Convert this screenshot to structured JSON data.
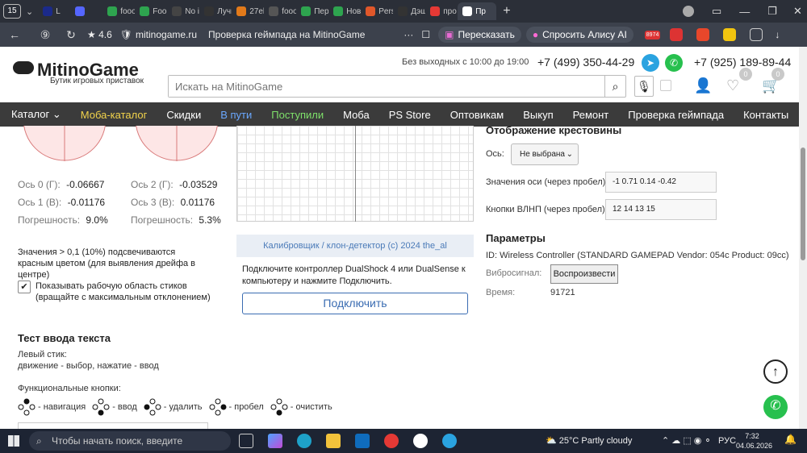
{
  "browser": {
    "tab_count": "15",
    "tabs": [
      {
        "label": "L",
        "color": "#1b2a8a"
      },
      {
        "label": "",
        "color": "#5566ff"
      },
      {
        "label": "fooo",
        "color": "#2ea44f"
      },
      {
        "label": "Food",
        "color": "#2ea44f"
      },
      {
        "label": "No il",
        "color": "#444"
      },
      {
        "label": "Лучи",
        "color": "#333"
      },
      {
        "label": "27el",
        "color": "#e27a1a"
      },
      {
        "label": "fooo",
        "color": "#555"
      },
      {
        "label": "Пер",
        "color": "#2ea44f"
      },
      {
        "label": "Нов",
        "color": "#2ea44f"
      },
      {
        "label": "Pers",
        "color": "#e0572a"
      },
      {
        "label": "Дэш",
        "color": "#333"
      },
      {
        "label": "про",
        "color": "#e53935"
      },
      {
        "label": "Пр",
        "color": "#fff",
        "active": true
      }
    ],
    "rating": "★ 4.6",
    "domain": "mitinogame.ru",
    "page_title": "Проверка геймпада на MitinoGame",
    "retell_label": "Пересказать",
    "alice_label": "Спросить Алису AI",
    "ext_badge": "8974"
  },
  "site": {
    "logo": "MitinoGame",
    "logo_sub": "Бутик игровых приставок",
    "hours": "Без выходных с 10:00 до 19:00",
    "phone1": "+7 (499) 350-44-29",
    "phone2": "+7 (925) 189-89-44",
    "search_placeholder": "Искать на MitinoGame",
    "fav_count": "0",
    "cart_count": "0",
    "menu": [
      {
        "label": "Каталог ⌄",
        "color": "#ffffff"
      },
      {
        "label": "Моба-каталог",
        "color": "#f2d34b"
      },
      {
        "label": "Скидки",
        "color": "#ffffff"
      },
      {
        "label": "В пути",
        "color": "#6aa8ff"
      },
      {
        "label": "Поступили",
        "color": "#7ee06a"
      },
      {
        "label": "Моба",
        "color": "#ffffff"
      },
      {
        "label": "PS Store",
        "color": "#ffffff"
      },
      {
        "label": "Оптовикам",
        "color": "#ffffff"
      },
      {
        "label": "Выкуп",
        "color": "#ffffff"
      },
      {
        "label": "Ремонт",
        "color": "#ffffff"
      },
      {
        "label": "Проверка геймпада",
        "color": "#ffffff"
      },
      {
        "label": "Контакты",
        "color": "#ffffff"
      }
    ]
  },
  "tester": {
    "left": {
      "axis0_label": "Ось 0 (Г):",
      "axis0_value": "-0.06667",
      "axis1_label": "Ось 1 (В):",
      "axis1_value": "-0.01176",
      "error_label": "Погрешность:",
      "error_value": "9.0%"
    },
    "right": {
      "axis2_label": "Ось 2 (Г):",
      "axis2_value": "-0.03529",
      "axis3_label": "Ось 3 (В):",
      "axis3_value": "0.01176",
      "error_label": "Погрешность:",
      "error_value": "5.3%"
    },
    "drift_note": "Значения > 0,1 (10%) подсвечиваются красным цветом (для выявления дрейфа в центре)",
    "show_area_label": "Показывать рабочую область стиков (вращайте с максимальным отклонением)",
    "show_area_checked": true,
    "calibrator": "Калибровщик / клон-детектор (c) 2024 the_al",
    "connect_text": "Подключите контроллер DualShock 4 или DualSense к компьютеру и нажмите Подключить.",
    "connect_button": "Подключить",
    "dpad_title": "Отображение крестовины",
    "axis_label": "Ось:",
    "axis_select": "Не выбрана",
    "axis_values_label": "Значения оси (через пробел):",
    "axis_values": "-1 0.71 0.14 -0.42",
    "buttons_label": "Кнопки ВЛНП (через пробел):",
    "buttons_values": "12 14 13 15",
    "params_title": "Параметры",
    "id_text": "ID: Wireless Controller (STANDARD GAMEPAD Vendor: 054c Product: 09cc)",
    "vibration_label": "Вибросигнал:",
    "vibration_button": "Воспроизвести",
    "time_label": "Время:",
    "time_value": "91721"
  },
  "text_input_test": {
    "title": "Тест ввода текста",
    "left_stick_label": "Левый стик:",
    "left_stick_desc": "движение - выбор, нажатие - ввод",
    "func_label": "Функциональные кнопки:",
    "funcs": [
      "- навигация",
      "- ввод",
      "- удалить",
      "- пробел",
      "- очистить"
    ]
  },
  "taskbar": {
    "search_placeholder": "Чтобы начать поиск, введите",
    "weather": "25°C  Partly cloudy",
    "lang": "РУС",
    "time": "7:32",
    "date": "04.06.2026"
  }
}
